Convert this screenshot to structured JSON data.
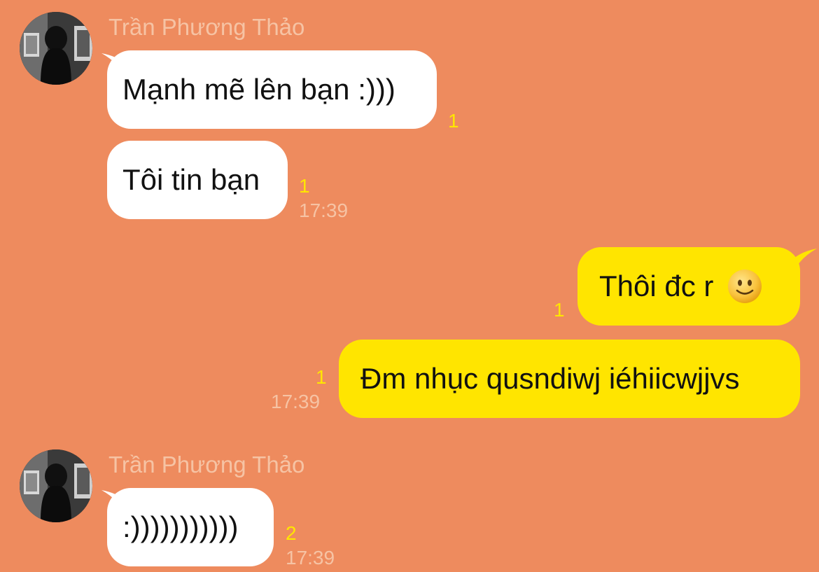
{
  "chat": {
    "background": "#EE8B5E",
    "incoming_bubble_color": "#FFFFFF",
    "outgoing_bubble_color": "#FFE500",
    "unread_count_color": "#FFE600",
    "group1": {
      "sender": "Trần Phương Thảo",
      "avatar_icon": "profile-photo",
      "messages": [
        {
          "text": "Mạnh mẽ lên bạn :)))",
          "unread": "1"
        },
        {
          "text": "Tôi tin bạn",
          "unread": "1",
          "time": "17:39"
        }
      ]
    },
    "group2": {
      "messages": [
        {
          "text": "Thôi đc r",
          "emoji": "slightly-smiling-face-icon",
          "unread": "1"
        },
        {
          "text": "Đm nhục qusndiwj iéhiicwjjvs",
          "unread": "1",
          "time": "17:39"
        }
      ]
    },
    "group3": {
      "sender": "Trần Phương Thảo",
      "avatar_icon": "profile-photo",
      "messages": [
        {
          "text": ":)))))))))))",
          "unread": "2",
          "time": "17:39"
        }
      ]
    }
  }
}
